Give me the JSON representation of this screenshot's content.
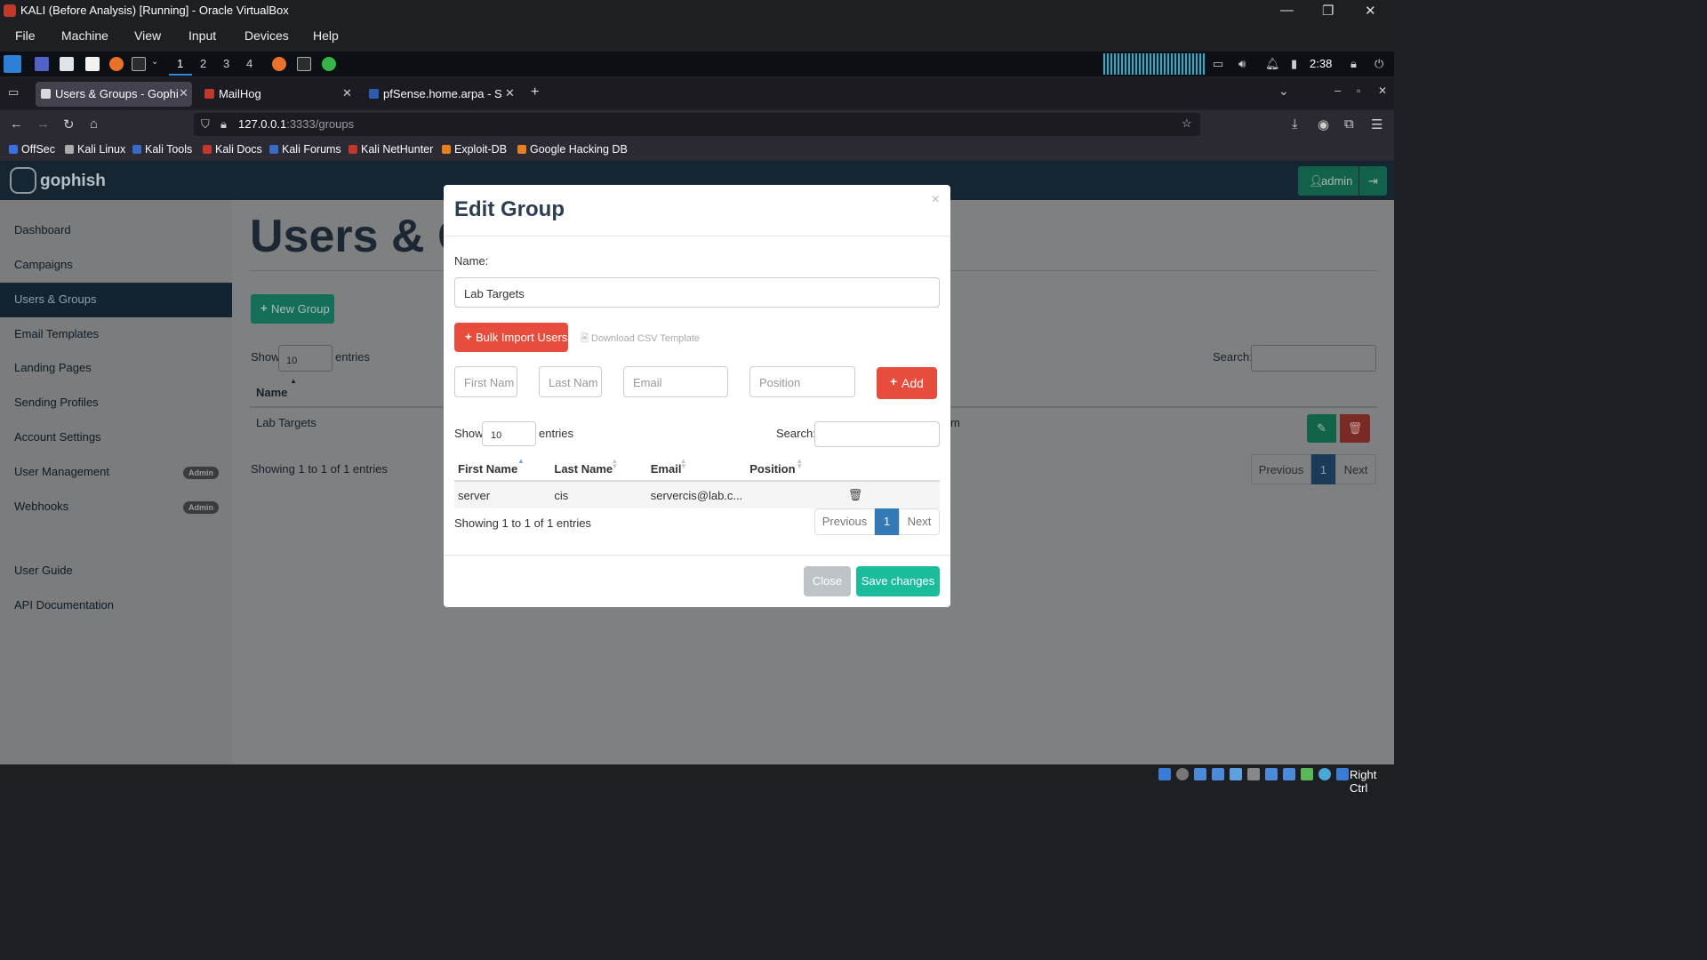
{
  "vbox": {
    "title": "KALI (Before Analysis) [Running] - Oracle VirtualBox",
    "menu": [
      "File",
      "Machine",
      "View",
      "Input",
      "Devices",
      "Help"
    ],
    "host_key": "Right Ctrl"
  },
  "panel": {
    "workspaces": [
      "1",
      "2",
      "3",
      "4"
    ],
    "clock": "2:38"
  },
  "browser": {
    "tabs": [
      {
        "label": "Users & Groups - Gophish",
        "active": true
      },
      {
        "label": "MailHog",
        "active": false
      },
      {
        "label": "pfSense.home.arpa - Stat",
        "active": false
      }
    ],
    "url_host": "127.0.0.1",
    "url_rest": ":3333/groups",
    "bookmarks": [
      "OffSec",
      "Kali Linux",
      "Kali Tools",
      "Kali Docs",
      "Kali Forums",
      "Kali NetHunter",
      "Exploit-DB",
      "Google Hacking DB"
    ]
  },
  "gophish": {
    "brand": "gophish",
    "admin_label": "admin",
    "sidebar": [
      {
        "label": "Dashboard"
      },
      {
        "label": "Campaigns"
      },
      {
        "label": "Users & Groups",
        "active": true
      },
      {
        "label": "Email Templates"
      },
      {
        "label": "Landing Pages"
      },
      {
        "label": "Sending Profiles"
      },
      {
        "label": "Account Settings"
      },
      {
        "label": "User Management",
        "badge": "Admin"
      },
      {
        "label": "Webhooks",
        "badge": "Admin"
      },
      {
        "label": "User Guide"
      },
      {
        "label": "API Documentation"
      }
    ],
    "main": {
      "title": "Users & G",
      "new_group_label": "New Group",
      "show_label": "Show",
      "entries_value": "10",
      "entries_label": "entries",
      "search_label": "Search:",
      "col_name": "Name",
      "row_name": "Lab Targets",
      "row_suffix": "m",
      "showing": "Showing 1 to 1 of 1 entries",
      "prev": "Previous",
      "page": "1",
      "next": "Next"
    }
  },
  "modal": {
    "title": "Edit Group",
    "close_x": "×",
    "name_label": "Name:",
    "name_value": "Lab Targets",
    "bulk_import_label": "Bulk Import Users",
    "download_csv_label": "Download CSV Template",
    "placeholders": {
      "first": "First Nam",
      "last": "Last Nam",
      "email": "Email",
      "position": "Position"
    },
    "add_label": "Add",
    "show_label": "Show",
    "entries_value": "10",
    "entries_label": "entries",
    "search_label": "Search:",
    "columns": [
      "First Name",
      "Last Name",
      "Email",
      "Position"
    ],
    "rows": [
      {
        "first": "server",
        "last": "cis",
        "email": "servercis@lab.c...",
        "position": ""
      }
    ],
    "showing": "Showing 1 to 1 of 1 entries",
    "prev": "Previous",
    "page": "1",
    "next": "Next",
    "close_label": "Close",
    "save_label": "Save changes"
  },
  "colors": {
    "gophish_green": "#1abc9c",
    "danger_red": "#e74c3c",
    "primary_blue": "#337ab7",
    "sidebar_active": "#132430"
  }
}
